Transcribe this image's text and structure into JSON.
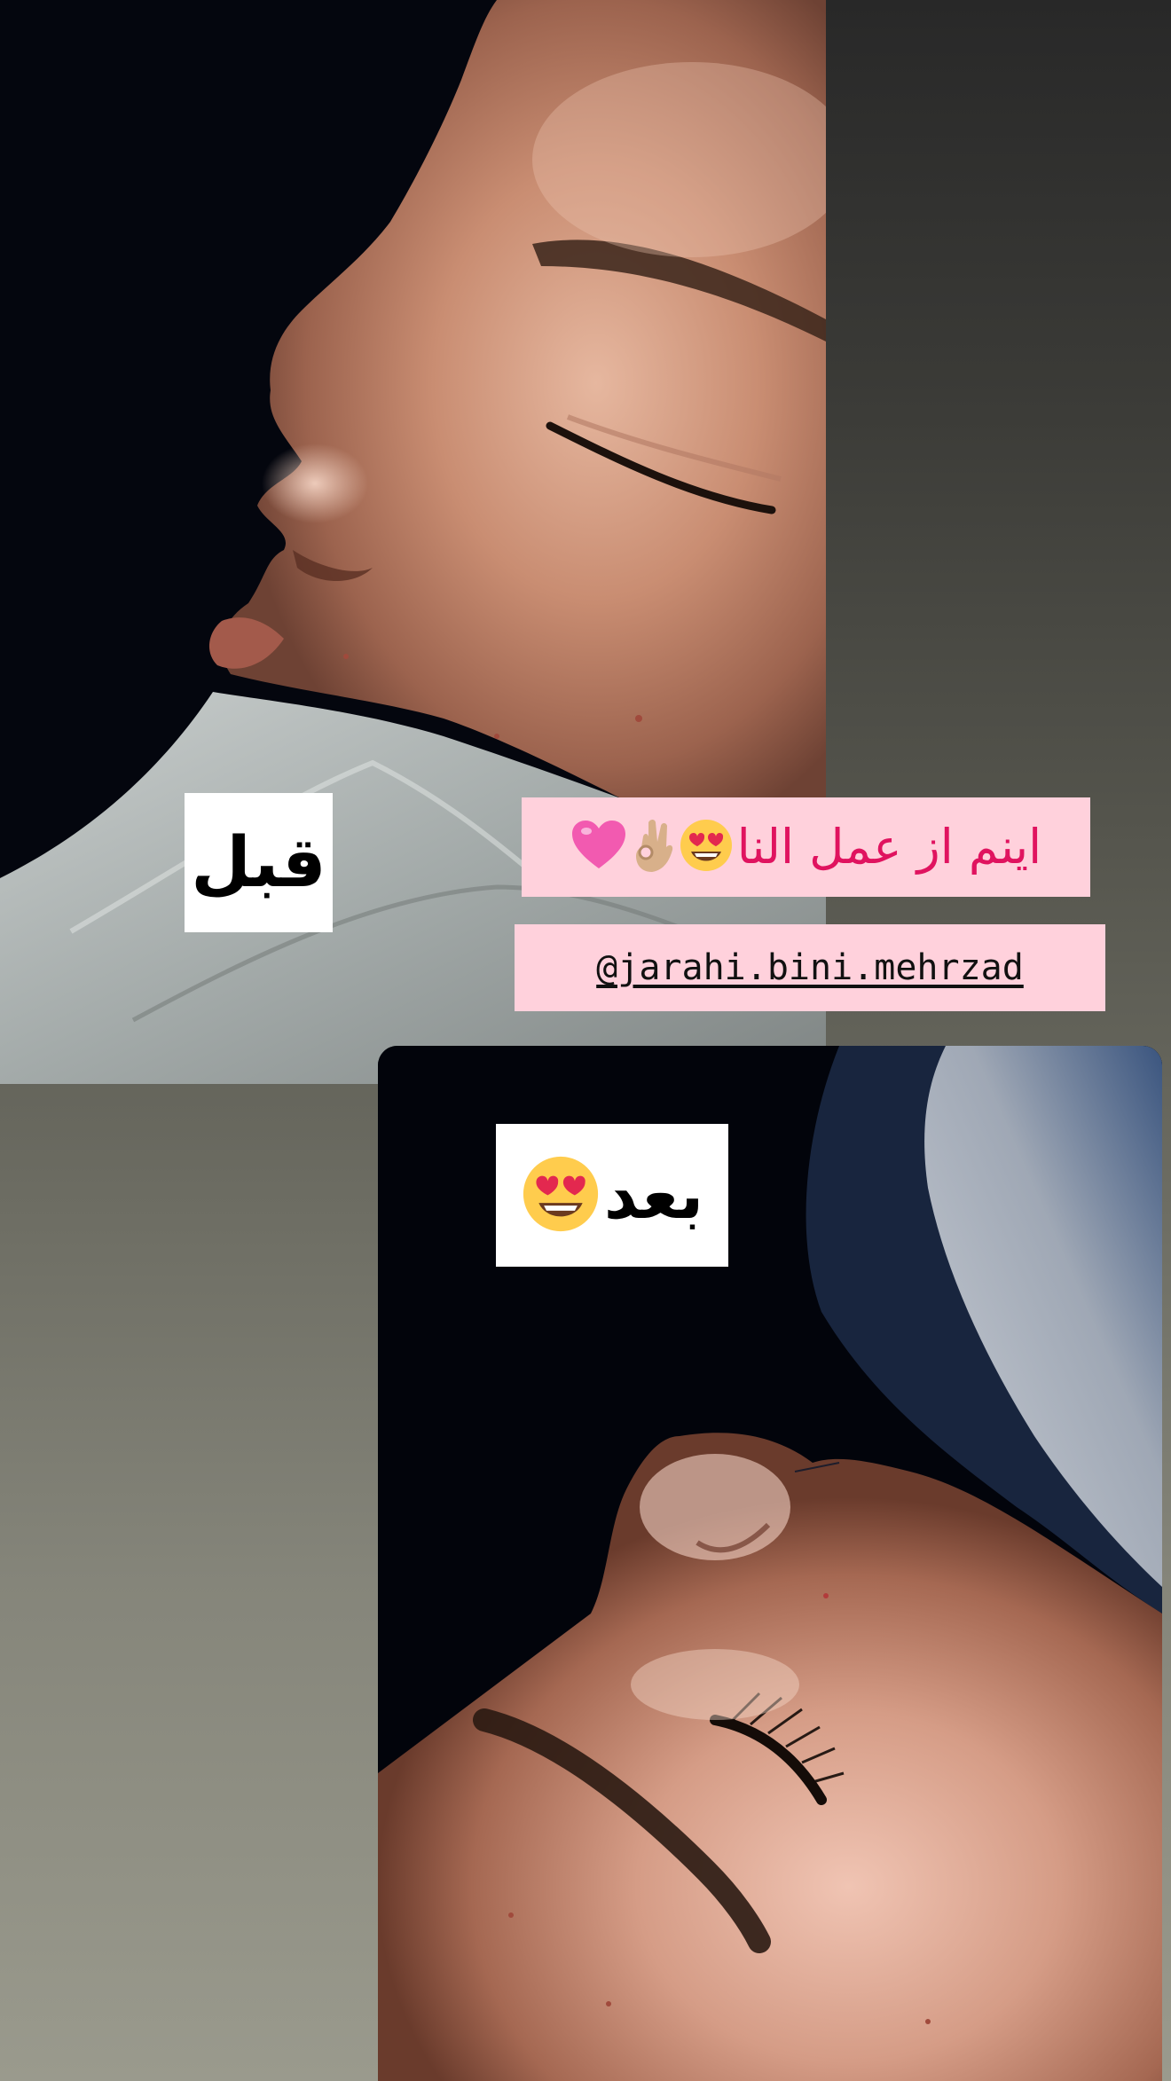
{
  "story": {
    "before_label": "قبل",
    "after_label": "بعد",
    "caption": "اینم از عمل النا",
    "handle": "@jarahi.bini.mehrzad",
    "caption_emojis": [
      "heart-eyes-emoji",
      "ok-hand-emoji",
      "pink-heart-emoji"
    ],
    "after_label_emoji": "heart-eyes-emoji",
    "colors": {
      "caption_bg": "#ffd1dc",
      "caption_text": "#e0135f",
      "label_bg": "#ffffff"
    }
  }
}
